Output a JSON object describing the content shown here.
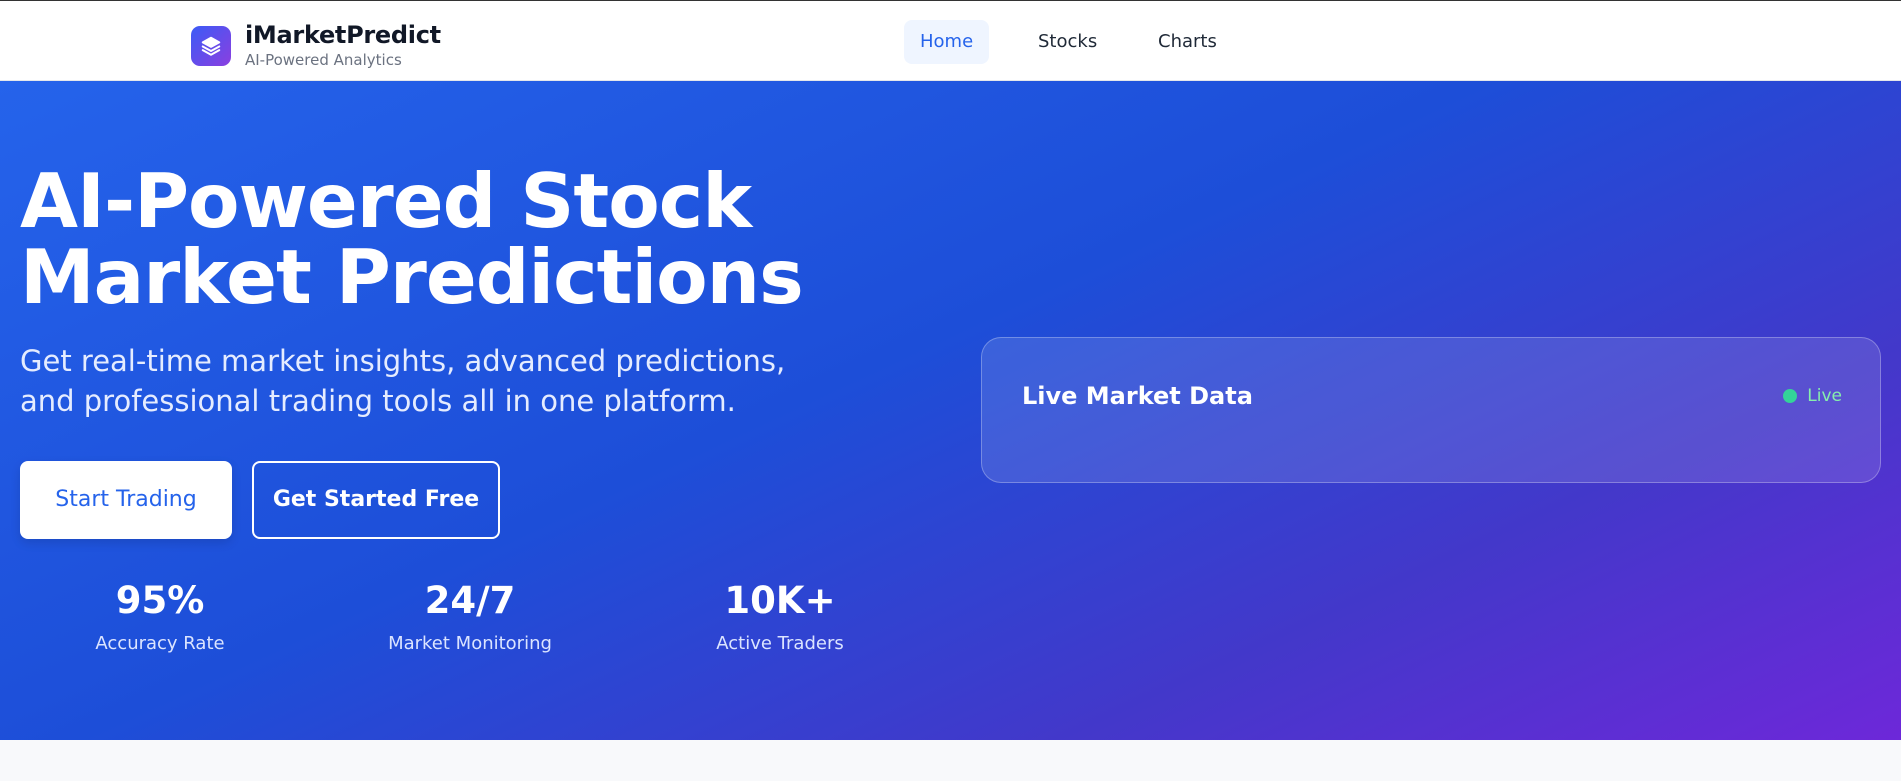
{
  "brand": {
    "name": "iMarketPredict",
    "tagline": "AI-Powered Analytics",
    "logo_icon": "layers-icon"
  },
  "nav": {
    "items": [
      {
        "label": "Home",
        "active": true
      },
      {
        "label": "Stocks",
        "active": false
      },
      {
        "label": "Charts",
        "active": false
      }
    ]
  },
  "hero": {
    "title": "AI-Powered Stock Market Predictions",
    "subtitle": "Get real-time market insights, advanced predictions, and professional trading tools all in one platform.",
    "primary_button": "Start Trading",
    "secondary_button": "Get Started Free",
    "stats": [
      {
        "value": "95%",
        "label": "Accuracy Rate"
      },
      {
        "value": "24/7",
        "label": "Market Monitoring"
      },
      {
        "value": "10K+",
        "label": "Active Traders"
      }
    ]
  },
  "market_card": {
    "title": "Live Market Data",
    "status": "Live",
    "status_color": "#34d399"
  },
  "colors": {
    "accent": "#2563eb",
    "gradient_start": "#2563eb",
    "gradient_end": "#6d28d9"
  }
}
